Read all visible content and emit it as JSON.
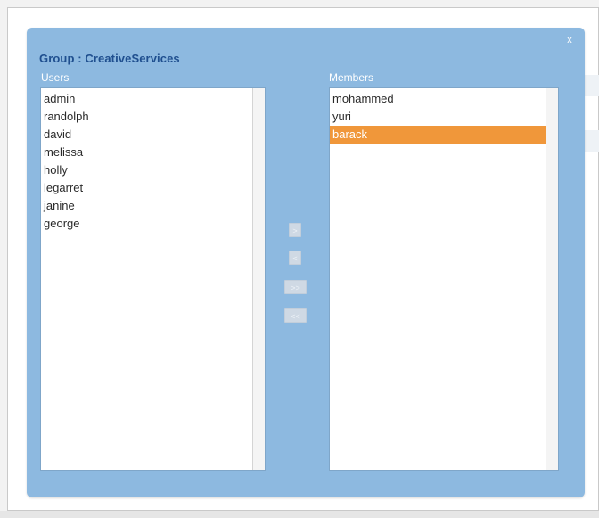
{
  "dialog": {
    "title": "Group : CreativeServices",
    "close_label": "x"
  },
  "users": {
    "label": "Users",
    "items": [
      "admin",
      "randolph",
      "david",
      "melissa",
      "holly",
      "legarret",
      "janine",
      "george"
    ]
  },
  "members": {
    "label": "Members",
    "items": [
      "mohammed",
      "yuri",
      "barack"
    ],
    "selected": "barack"
  },
  "transfer_buttons": {
    "add_selected": ">",
    "remove_selected": "<",
    "add_all": ">>",
    "remove_all": "<<"
  },
  "colors": {
    "dialog_bg": "#8db9e0",
    "title": "#1f4f8f",
    "selection": "#f0973a"
  }
}
